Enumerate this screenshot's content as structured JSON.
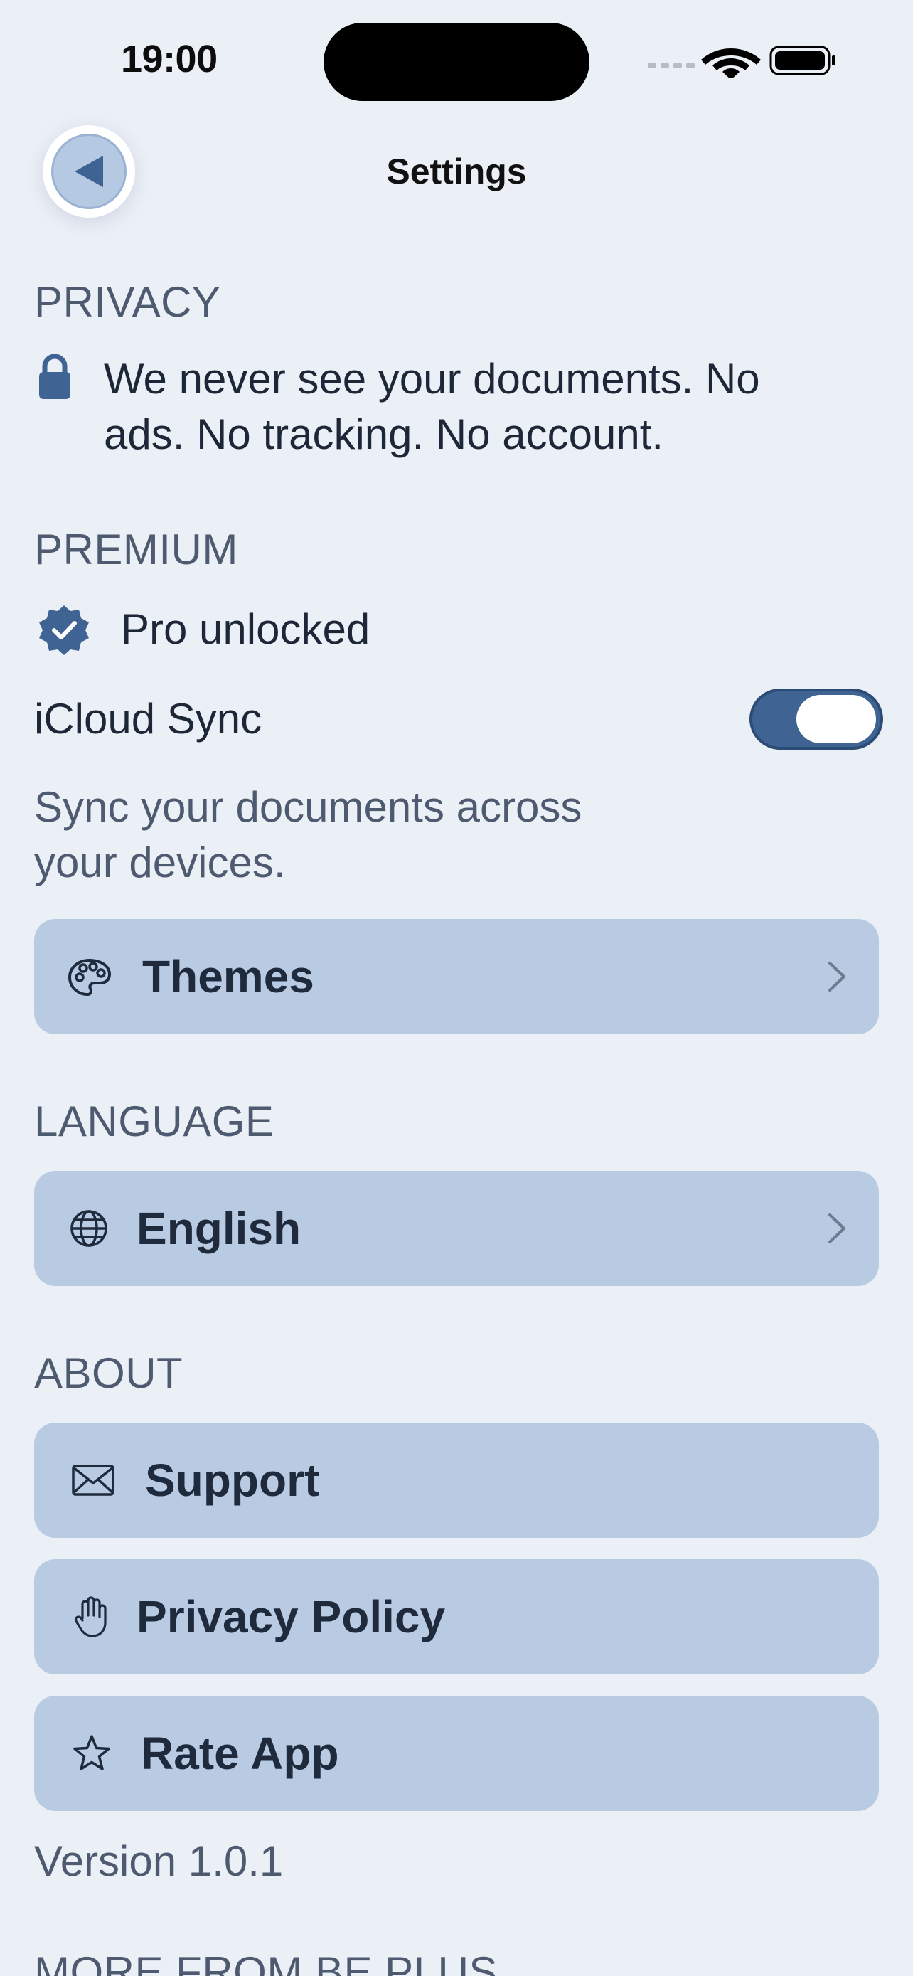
{
  "status_bar": {
    "time": "19:00"
  },
  "nav": {
    "title": "Settings",
    "back_icon": "back-arrow-icon"
  },
  "privacy": {
    "header": "PRIVACY",
    "line1": "We never see your documents. No",
    "line2": "ads. No tracking. No account."
  },
  "premium": {
    "header": "PREMIUM",
    "pro_label": "Pro unlocked",
    "icloud_label": "iCloud Sync",
    "icloud_enabled": true,
    "sync_line1": "Sync your documents across",
    "sync_line2": "your devices.",
    "themes_label": "Themes"
  },
  "language": {
    "header": "LANGUAGE",
    "value": "English"
  },
  "about": {
    "header": "ABOUT",
    "support_label": "Support",
    "privacy_policy_label": "Privacy Policy",
    "rate_label": "Rate App",
    "version": "Version 1.0.1",
    "more_header": "MORE FROM BE PLUS"
  },
  "colors": {
    "accent": "#3f6392",
    "card": "#b8cbe3",
    "background": "#ebeff6"
  }
}
